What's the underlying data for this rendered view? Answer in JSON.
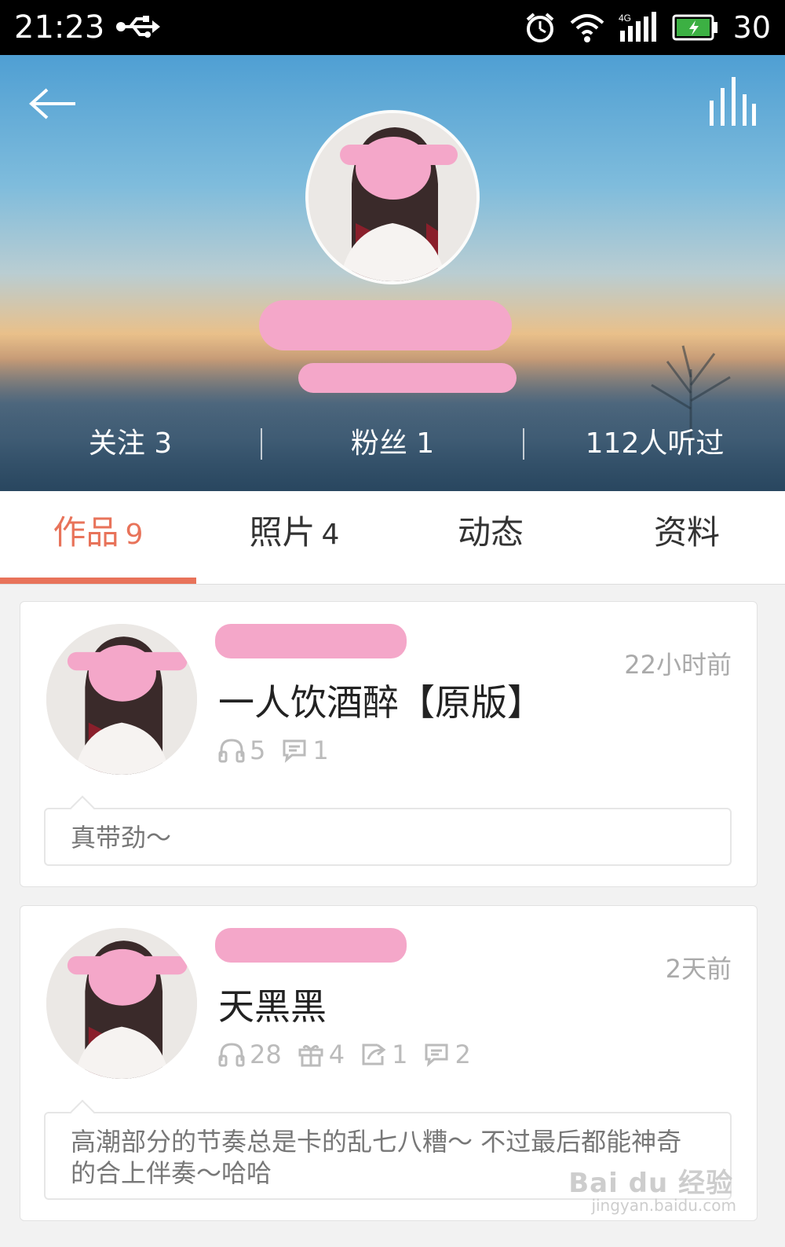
{
  "status_bar": {
    "time": "21:23",
    "battery_level": "30",
    "icons": [
      "usb-icon",
      "alarm-icon",
      "wifi-icon",
      "signal-4g-icon",
      "battery-icon"
    ]
  },
  "profile": {
    "stats": {
      "following": "关注 3",
      "fans": "粉丝 1",
      "listened": "112人听过"
    }
  },
  "tabs": [
    {
      "label": "作品",
      "count": "9",
      "active": true
    },
    {
      "label": "照片",
      "count": "4",
      "active": false
    },
    {
      "label": "动态",
      "count": "",
      "active": false
    },
    {
      "label": "资料",
      "count": "",
      "active": false
    }
  ],
  "works": [
    {
      "time": "22小时前",
      "title": "一人饮酒醉【原版】",
      "metrics": {
        "listens": "5",
        "comments": "1"
      },
      "comment": "真带劲～"
    },
    {
      "time": "2天前",
      "title": "天黑黑",
      "metrics": {
        "listens": "28",
        "gifts": "4",
        "shares": "1",
        "comments": "2"
      },
      "comment": "高潮部分的节奏总是卡的乱七八糟～ 不过最后都能神奇的合上伴奏～哈哈"
    }
  ],
  "watermark": {
    "main": "Bai du 经验",
    "sub": "jingyan.baidu.com"
  },
  "colors": {
    "accent": "#e8735a",
    "redaction": "#f4a7c9"
  }
}
